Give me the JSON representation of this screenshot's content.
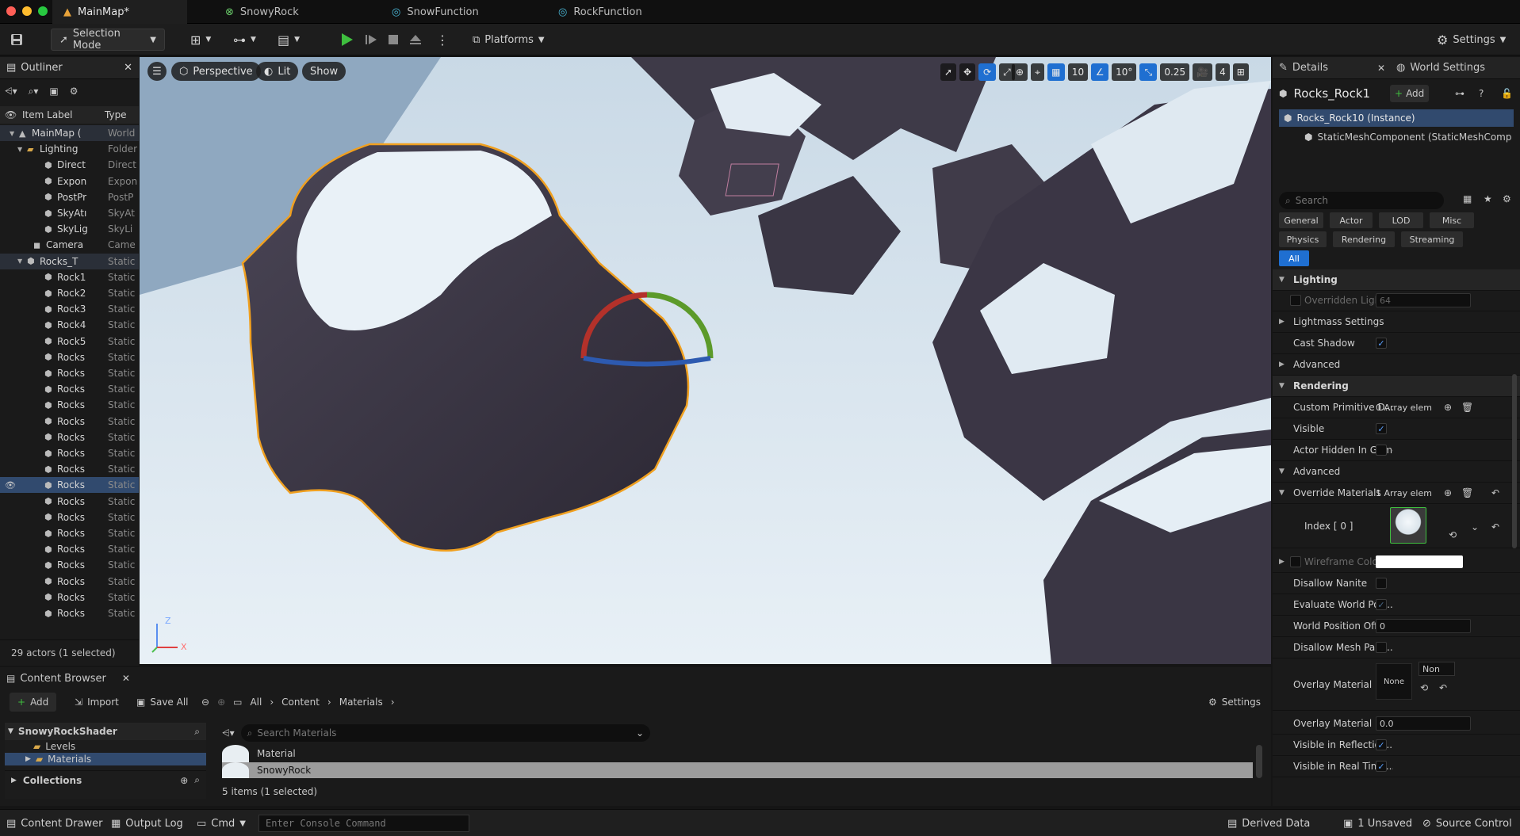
{
  "titlebar": {
    "tabs": [
      {
        "label": "MainMap*",
        "icon": "level-icon"
      },
      {
        "label": "SnowyRock",
        "icon": "material-icon"
      },
      {
        "label": "SnowFunction",
        "icon": "material-function-icon"
      },
      {
        "label": "RockFunction",
        "icon": "material-function-icon"
      }
    ]
  },
  "toolbar": {
    "selection_mode": "Selection Mode",
    "platforms": "Platforms",
    "settings": "Settings"
  },
  "outliner": {
    "tab_label": "Outliner",
    "col_label": "Item Label",
    "col_type": "Type",
    "rows": [
      {
        "label": "MainMap (",
        "type": "World"
      },
      {
        "label": "Lighting",
        "type": "Folder"
      },
      {
        "label": "Direct",
        "type": "Direct"
      },
      {
        "label": "Expon",
        "type": "Expon"
      },
      {
        "label": "PostPr",
        "type": "PostP"
      },
      {
        "label": "SkyAtı",
        "type": "SkyAt"
      },
      {
        "label": "SkyLig",
        "type": "SkyLi"
      },
      {
        "label": "Camera",
        "type": "Came"
      },
      {
        "label": "Rocks_T",
        "type": "Static"
      },
      {
        "label": "Rock1",
        "type": "Static"
      },
      {
        "label": "Rock2",
        "type": "Static"
      },
      {
        "label": "Rock3",
        "type": "Static"
      },
      {
        "label": "Rock4",
        "type": "Static"
      },
      {
        "label": "Rock5",
        "type": "Static"
      },
      {
        "label": "Rocks",
        "type": "Static"
      },
      {
        "label": "Rocks",
        "type": "Static"
      },
      {
        "label": "Rocks",
        "type": "Static"
      },
      {
        "label": "Rocks",
        "type": "Static"
      },
      {
        "label": "Rocks",
        "type": "Static"
      },
      {
        "label": "Rocks",
        "type": "Static"
      },
      {
        "label": "Rocks",
        "type": "Static"
      },
      {
        "label": "Rocks",
        "type": "Static"
      },
      {
        "label": "Rocks",
        "type": "Static"
      },
      {
        "label": "Rocks",
        "type": "Static"
      },
      {
        "label": "Rocks",
        "type": "Static"
      },
      {
        "label": "Rocks",
        "type": "Static"
      },
      {
        "label": "Rocks",
        "type": "Static"
      },
      {
        "label": "Rocks",
        "type": "Static"
      },
      {
        "label": "Rocks",
        "type": "Static"
      },
      {
        "label": "Rocks",
        "type": "Static"
      },
      {
        "label": "Rocks",
        "type": "Static"
      }
    ],
    "footer": "29 actors (1 selected)"
  },
  "viewport": {
    "perspective": "Perspective",
    "lit": "Lit",
    "show": "Show",
    "grid_snap": "10",
    "rot_snap": "10°",
    "scale_snap": "0.25",
    "camera_speed": "4",
    "axis_x": "X",
    "axis_z": "Z"
  },
  "details": {
    "tab_label": "Details",
    "world_settings_tab": "World Settings",
    "actor_name": "Rocks_Rock1",
    "add_label": "Add",
    "instance_label": "Rocks_Rock10 (Instance)",
    "component_label": "StaticMeshComponent (StaticMeshComp",
    "search_placeholder": "Search",
    "filters": [
      "General",
      "Actor",
      "LOD",
      "Misc",
      "Physics",
      "Rendering",
      "Streaming",
      "All"
    ],
    "lighting_section": "Lighting",
    "overridden_light": "Overridden Ligh...",
    "overridden_light_value": "64",
    "lightmass_settings": "Lightmass Settings",
    "cast_shadow": "Cast Shadow",
    "advanced": "Advanced",
    "rendering_section": "Rendering",
    "custom_primitive": "Custom Primitive D...",
    "custom_primitive_value": "0 Array elem",
    "visible": "Visible",
    "actor_hidden": "Actor Hidden In Game",
    "advanced2": "Advanced",
    "override_materials": "Override Materials",
    "override_materials_value": "1 Array elem",
    "index0": "Index [ 0 ]",
    "wireframe_color": "Wireframe Colo...",
    "disallow_nanite": "Disallow Nanite",
    "evaluate_wpo": "Evaluate World Posi...",
    "wpo_distance": "World Position Offs...",
    "wpo_distance_value": "0",
    "disallow_mesh_paint": "Disallow Mesh Pain...",
    "overlay_material": "Overlay Material",
    "overlay_none": "None",
    "overlay_dropdown": "Non",
    "overlay_material_max": "Overlay Material M...",
    "overlay_material_max_value": "0.0",
    "visible_reflection": "Visible in Reflection...",
    "visible_realtime": "Visible in Real Time..."
  },
  "content_browser": {
    "tab_label": "Content Browser",
    "add": "Add",
    "import": "Import",
    "save_all": "Save All",
    "breadcrumb": [
      "All",
      "Content",
      "Materials"
    ],
    "settings": "Settings",
    "project": "SnowyRockShader",
    "folders": [
      "Levels",
      "Materials"
    ],
    "collections": "Collections",
    "search_placeholder": "Search Materials",
    "items": [
      "Material",
      "SnowyRock"
    ],
    "status": "5 items (1 selected)"
  },
  "statusbar": {
    "content_drawer": "Content Drawer",
    "output_log": "Output Log",
    "cmd": "Cmd",
    "console_placeholder": "Enter Console Command",
    "derived_data": "Derived Data",
    "unsaved": "1 Unsaved",
    "source_control": "Source Control"
  },
  "colors": {
    "accent": "#1f6fd1",
    "selection_outline": "#f0a020",
    "play_green": "#3fbf3f"
  }
}
